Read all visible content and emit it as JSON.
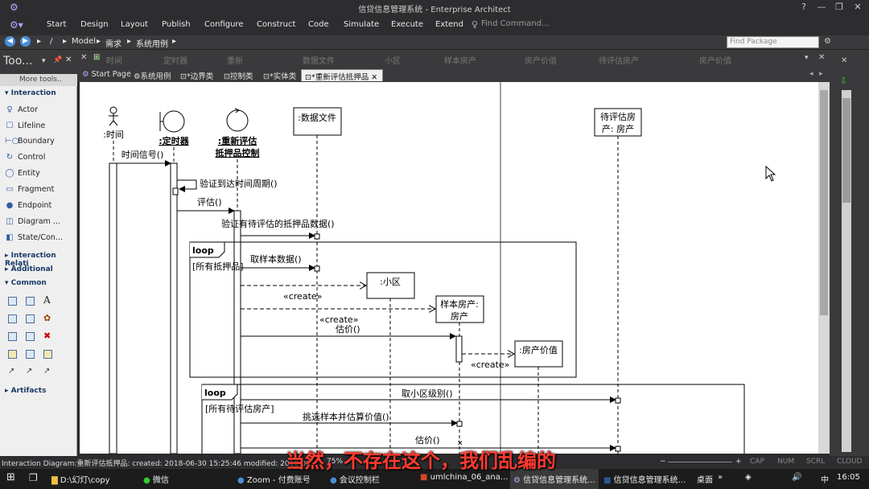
{
  "window": {
    "title": "信贷信息管理系统 - Enterprise Architect"
  },
  "menu": {
    "items": [
      "Start",
      "Design",
      "Layout",
      "Publish",
      "Configure",
      "Construct",
      "Code",
      "Simulate",
      "Execute",
      "Extend"
    ],
    "find_command": "Find Command..."
  },
  "addressbar": {
    "slash": "/",
    "crumbs": [
      "Model",
      "需求",
      "系统用例"
    ],
    "find_package_placeholder": "Find Package"
  },
  "toolbox": {
    "title": "Too...",
    "more_tools": "More tools..",
    "sections": {
      "interaction": "Interaction",
      "interaction_relations": "Interaction Relati",
      "additional": "Additional",
      "common": "Common",
      "artifacts": "Artifacts"
    },
    "items": [
      "Actor",
      "Lifeline",
      "Boundary",
      "Control",
      "Entity",
      "Fragment",
      "Endpoint",
      "Diagram ...",
      "State/Con..."
    ]
  },
  "ghost_headers": [
    "时间",
    "定时器",
    "重新",
    "数据文件",
    "小区",
    "样本房产",
    "房产价值",
    "待评估房产",
    "房产价值"
  ],
  "tabs": [
    "Start Page",
    "系统用例",
    "*边界类",
    "控制类",
    "*实体类",
    "*重新评估抵押品"
  ],
  "diagram": {
    "lifelines": {
      "timer_actor": ":时间",
      "boundary": ":定时器",
      "control_line1": ":重新评估",
      "control_line2": "抵押品控制",
      "datafile": ":数据文件",
      "estate_line1": "待评估房",
      "estate_line2": "产: 房产",
      "district": ":小区",
      "sample_line1": "样本房产:",
      "sample_line2": "房产",
      "value": ":房产价值"
    },
    "messages": {
      "time_signal": "时间信号()",
      "verify_period": "验证到达时间周期()",
      "evaluate": "评估()",
      "verify_data": "验证有待评估的抵押品数据()",
      "fetch_sample": "取样本数据()",
      "create1": "«create»",
      "create2": "«create»",
      "estimate": "估价()",
      "create3": "«create»",
      "get_level": "取小区级别()",
      "pick_sample": "挑选样本并估算价值()",
      "estimate2": "估价()"
    },
    "fragments": {
      "loop1_kw": "loop",
      "loop1_guard": "[所有抵押品]",
      "loop2_kw": "loop",
      "loop2_guard": "[所有待评估房产]"
    }
  },
  "statusbar": {
    "left": "Interaction Diagram:重新评估抵押品:  created: 2018-06-30 15:25:46  modified: 2018-06",
    "zoom": "75%",
    "cap": "CAP",
    "num": "NUM",
    "scrl": "SCRL",
    "cloud": "CLOUD"
  },
  "taskbar": {
    "apps": [
      "D:\\幻灯\\copy",
      "微信",
      "Zoom - 付费账号",
      "会议控制栏",
      "umlchina_06_ana...",
      "信贷信息管理系统...",
      "信贷信息管理系统..."
    ],
    "desk": "桌面",
    "ime": "中",
    "time": "16:05"
  },
  "subtitle": "当然，不存在这个，我们乱编的"
}
